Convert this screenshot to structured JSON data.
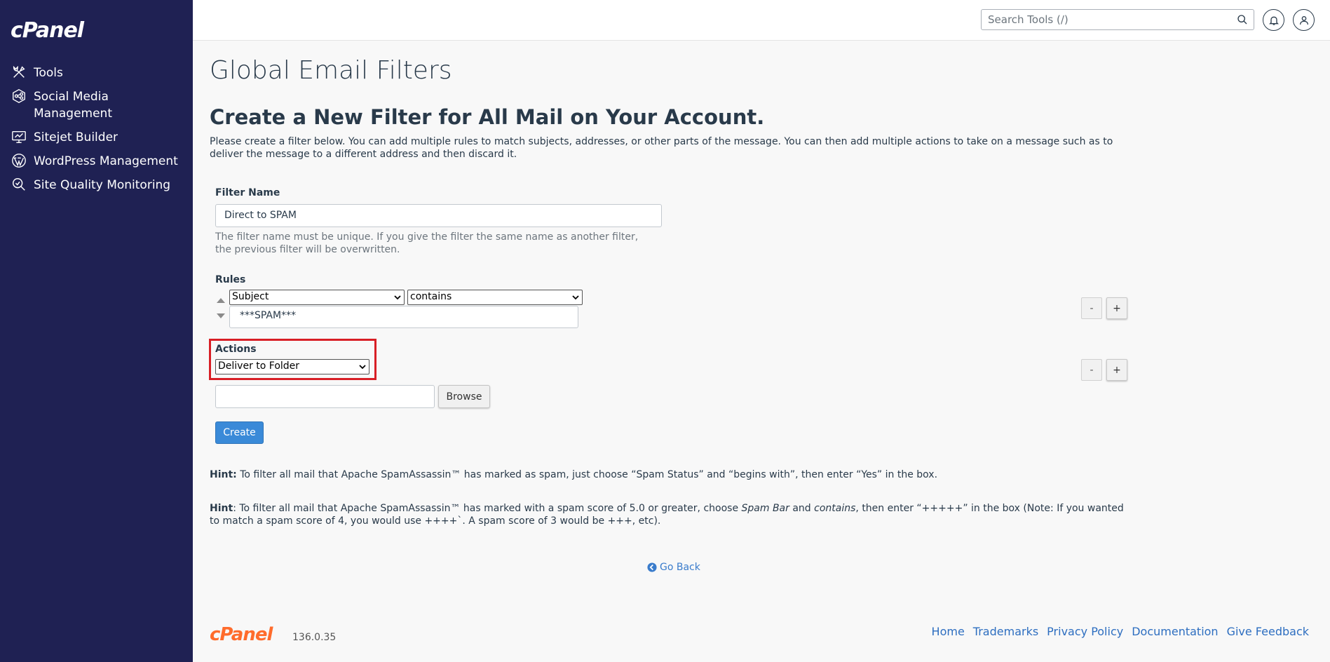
{
  "sidebar": {
    "logo": "cPanel",
    "items": [
      {
        "label": "Tools",
        "icon": "tools-icon"
      },
      {
        "label": "Social Media Management",
        "icon": "social-media-icon"
      },
      {
        "label": "Sitejet Builder",
        "icon": "sitejet-icon"
      },
      {
        "label": "WordPress Management",
        "icon": "wordpress-icon"
      },
      {
        "label": "Site Quality Monitoring",
        "icon": "site-quality-icon"
      }
    ]
  },
  "topbar": {
    "search_placeholder": "Search Tools (/)"
  },
  "page": {
    "title": "Global Email Filters",
    "section_title": "Create a New Filter for All Mail on Your Account.",
    "intro": "Please create a filter below. You can add multiple rules to match subjects, addresses, or other parts of the message. You can then add multiple actions to take on a message such as to deliver the message to a different address and then discard it."
  },
  "form": {
    "filter_name_label": "Filter Name",
    "filter_name_value": "Direct to SPAM",
    "filter_name_help": "The filter name must be unique. If you give the filter the same name as another filter, the previous filter will be overwritten.",
    "rules_label": "Rules",
    "rule_field": "Subject",
    "rule_operator": "contains",
    "rule_value": "***SPAM***",
    "actions_label": "Actions",
    "action_value": "Deliver to Folder",
    "folder_value": "",
    "browse_label": "Browse",
    "create_label": "Create",
    "minus_label": "-",
    "plus_label": "+"
  },
  "hints": {
    "hint1_label": "Hint:",
    "hint1_text": "To filter all mail that Apache SpamAssassin™ has marked as spam, just choose “Spam Status” and “begins with”, then enter “Yes” in the box.",
    "hint2_label": "Hint",
    "hint2_text_a": ": To filter all mail that Apache SpamAssassin™ has marked with a spam score of 5.0 or greater, choose ",
    "hint2_em1": "Spam Bar",
    "hint2_text_b": " and ",
    "hint2_em2": "contains",
    "hint2_text_c": ", then enter “+++++” in the box (Note: If you wanted to match a spam score of 4, you would use ++++`. A spam score of 3 would be +++, etc)."
  },
  "go_back": "Go Back",
  "footer": {
    "logo": "cPanel",
    "version": "136.0.35",
    "links": [
      "Home",
      "Trademarks",
      "Privacy Policy",
      "Documentation",
      "Give Feedback"
    ]
  },
  "colors": {
    "sidebar_bg": "#1f2153",
    "accent_blue": "#3a8ad8",
    "highlight_red": "#d81f26",
    "footer_logo": "#ff6c2c"
  }
}
